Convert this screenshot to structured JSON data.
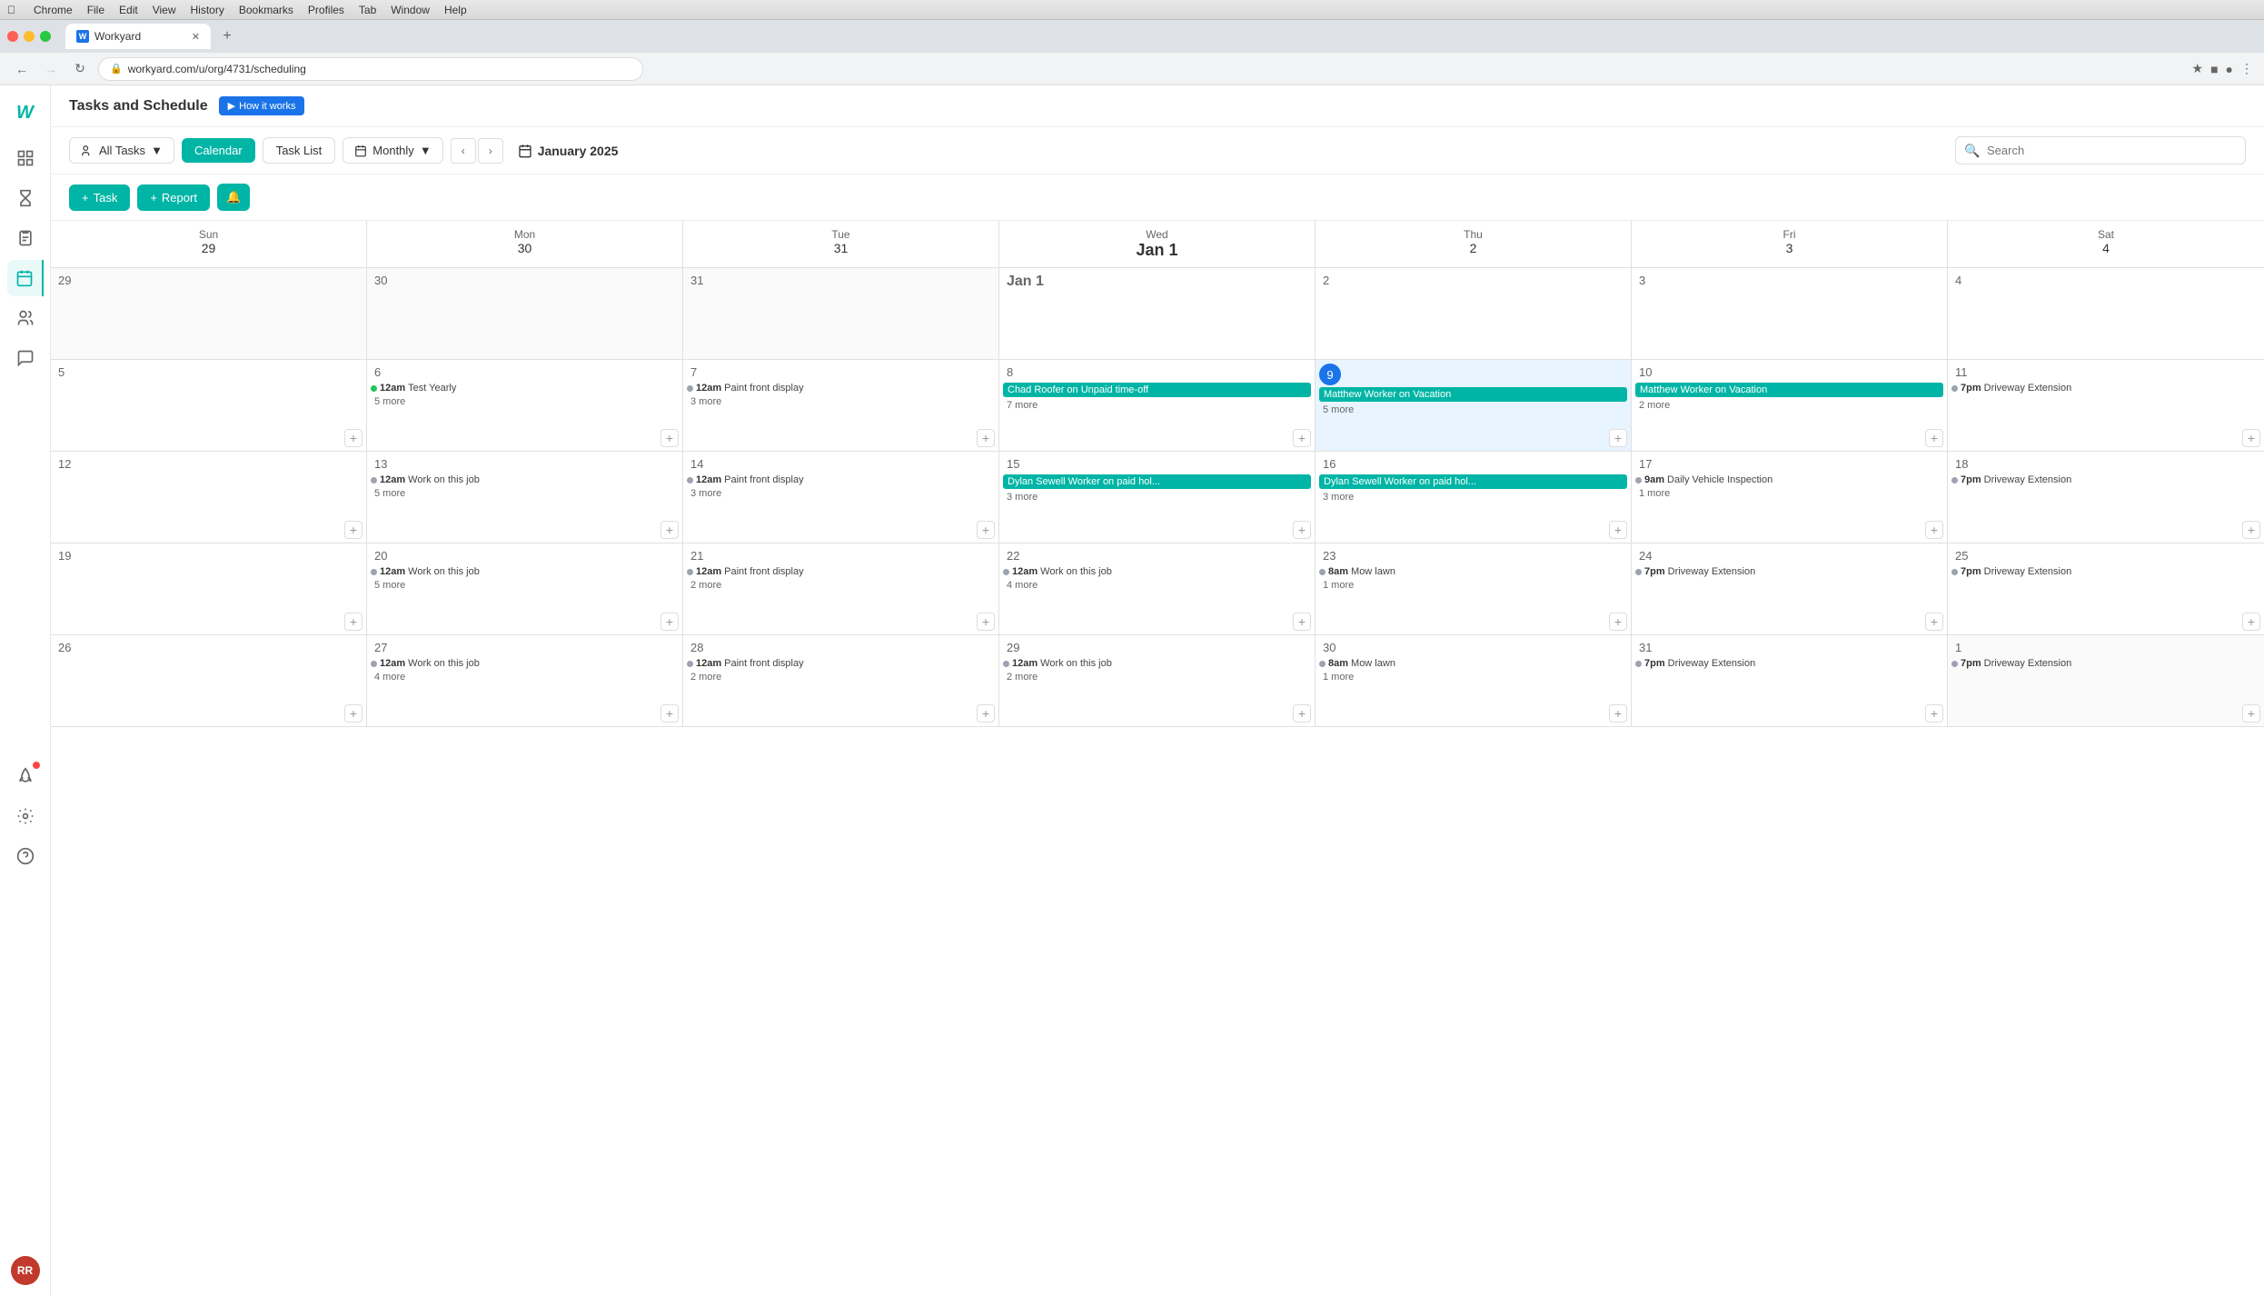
{
  "macos": {
    "menu_items": [
      "Apple",
      "Chrome",
      "File",
      "Edit",
      "View",
      "History",
      "Bookmarks",
      "Profiles",
      "Tab",
      "Window",
      "Help"
    ]
  },
  "tab": {
    "title": "Workyard",
    "favicon": "W"
  },
  "address": {
    "url": "workyard.com/u/org/4731/scheduling"
  },
  "header": {
    "title": "Tasks and Schedule",
    "how_it_works": "How it works"
  },
  "toolbar": {
    "all_tasks_label": "All Tasks",
    "calendar_label": "Calendar",
    "task_list_label": "Task List",
    "monthly_label": "Monthly",
    "month_display": "January 2025",
    "task_btn": "+ Task",
    "report_btn": "+ Report",
    "search_placeholder": "Search"
  },
  "calendar": {
    "day_headers": [
      {
        "day": "Sun",
        "num": "29",
        "today": false
      },
      {
        "day": "Mon",
        "num": "30",
        "today": false
      },
      {
        "day": "Tue",
        "num": "31",
        "today": false
      },
      {
        "day": "Wed",
        "num": "Jan 1",
        "today": false
      },
      {
        "day": "Thu",
        "num": "2",
        "today": false
      },
      {
        "day": "Fri",
        "num": "3",
        "today": false
      },
      {
        "day": "Sat",
        "num": "4",
        "today": false
      }
    ],
    "weeks": [
      {
        "days": [
          {
            "date": "29",
            "other": true,
            "events": [],
            "more": null
          },
          {
            "date": "30",
            "other": true,
            "events": [],
            "more": null
          },
          {
            "date": "31",
            "other": true,
            "events": [],
            "more": null
          },
          {
            "date": "Jan 1",
            "other": false,
            "big": true,
            "events": [],
            "more": null
          },
          {
            "date": "2",
            "other": false,
            "events": [],
            "more": null
          },
          {
            "date": "3",
            "other": false,
            "events": [],
            "more": null
          },
          {
            "date": "4",
            "other": false,
            "events": [],
            "more": null
          }
        ]
      },
      {
        "days": [
          {
            "date": "5",
            "other": false,
            "events": [],
            "more": null
          },
          {
            "date": "6",
            "other": false,
            "events": [
              {
                "type": "green-dot",
                "time": "12am",
                "text": "Test Yearly"
              }
            ],
            "more": "5 more"
          },
          {
            "date": "7",
            "other": false,
            "events": [
              {
                "type": "gray-dot",
                "time": "12am",
                "text": "Paint front display"
              }
            ],
            "more": "3 more"
          },
          {
            "date": "8",
            "other": false,
            "events": [
              {
                "type": "teal",
                "text": "Chad Roofer on Unpaid time-off"
              }
            ],
            "more": "7 more"
          },
          {
            "date": "9",
            "other": false,
            "today": true,
            "events": [
              {
                "type": "teal",
                "text": "Matthew Worker on Vacation"
              }
            ],
            "more": "5 more"
          },
          {
            "date": "10",
            "other": false,
            "events": [
              {
                "type": "teal",
                "text": "Matthew Worker on Vacation"
              }
            ],
            "more": "2 more"
          },
          {
            "date": "11",
            "other": false,
            "events": [
              {
                "type": "gray-dot",
                "time": "7pm",
                "text": "Driveway Extension"
              }
            ],
            "more": null
          }
        ]
      },
      {
        "days": [
          {
            "date": "12",
            "other": false,
            "events": [],
            "more": null
          },
          {
            "date": "13",
            "other": false,
            "events": [
              {
                "type": "gray-dot",
                "time": "12am",
                "text": "Work on this job"
              }
            ],
            "more": "5 more"
          },
          {
            "date": "14",
            "other": false,
            "events": [
              {
                "type": "gray-dot",
                "time": "12am",
                "text": "Paint front display"
              }
            ],
            "more": "3 more"
          },
          {
            "date": "15",
            "other": false,
            "events": [
              {
                "type": "teal",
                "text": "Dylan Sewell Worker on paid hol..."
              }
            ],
            "more": "3 more"
          },
          {
            "date": "16",
            "other": false,
            "events": [
              {
                "type": "teal",
                "text": "Dylan Sewell Worker on paid hol..."
              }
            ],
            "more": "3 more"
          },
          {
            "date": "17",
            "other": false,
            "events": [
              {
                "type": "gray-dot",
                "time": "9am",
                "text": "Daily Vehicle Inspection"
              }
            ],
            "more": "1 more"
          },
          {
            "date": "18",
            "other": false,
            "events": [
              {
                "type": "gray-dot",
                "time": "7pm",
                "text": "Driveway Extension"
              }
            ],
            "more": null
          }
        ]
      },
      {
        "days": [
          {
            "date": "19",
            "other": false,
            "events": [],
            "more": null
          },
          {
            "date": "20",
            "other": false,
            "events": [
              {
                "type": "gray-dot",
                "time": "12am",
                "text": "Work on this job"
              }
            ],
            "more": "5 more"
          },
          {
            "date": "21",
            "other": false,
            "events": [
              {
                "type": "gray-dot",
                "time": "12am",
                "text": "Paint front display"
              }
            ],
            "more": "2 more"
          },
          {
            "date": "22",
            "other": false,
            "events": [
              {
                "type": "gray-dot",
                "time": "12am",
                "text": "Work on this job"
              }
            ],
            "more": "4 more"
          },
          {
            "date": "23",
            "other": false,
            "events": [
              {
                "type": "gray-dot",
                "time": "8am",
                "text": "Mow lawn"
              }
            ],
            "more": "1 more"
          },
          {
            "date": "24",
            "other": false,
            "events": [
              {
                "type": "gray-dot",
                "time": "7pm",
                "text": "Driveway Extension"
              }
            ],
            "more": null
          },
          {
            "date": "25",
            "other": false,
            "events": [
              {
                "type": "gray-dot",
                "time": "7pm",
                "text": "Driveway Extension"
              }
            ],
            "more": null
          }
        ]
      },
      {
        "days": [
          {
            "date": "26",
            "other": false,
            "events": [],
            "more": null
          },
          {
            "date": "27",
            "other": false,
            "events": [
              {
                "type": "gray-dot",
                "time": "12am",
                "text": "Work on this job"
              }
            ],
            "more": "4 more"
          },
          {
            "date": "28",
            "other": false,
            "events": [
              {
                "type": "gray-dot",
                "time": "12am",
                "text": "Paint front display"
              }
            ],
            "more": "2 more"
          },
          {
            "date": "29",
            "other": false,
            "events": [
              {
                "type": "gray-dot",
                "time": "12am",
                "text": "Work on this job"
              }
            ],
            "more": "2 more"
          },
          {
            "date": "30",
            "other": false,
            "events": [
              {
                "type": "gray-dot",
                "time": "8am",
                "text": "Mow lawn"
              }
            ],
            "more": "1 more"
          },
          {
            "date": "31",
            "other": false,
            "events": [
              {
                "type": "gray-dot",
                "time": "7pm",
                "text": "Driveway Extension"
              }
            ],
            "more": null
          },
          {
            "date": "1",
            "other": true,
            "events": [
              {
                "type": "gray-dot",
                "time": "7pm",
                "text": "Driveway Extension"
              }
            ],
            "more": null
          }
        ]
      }
    ]
  },
  "sidebar": {
    "logo": "W",
    "avatar_initials": "RR",
    "items": [
      {
        "name": "dashboard",
        "icon": "grid"
      },
      {
        "name": "tasks",
        "icon": "hourglass"
      },
      {
        "name": "reports",
        "icon": "clipboard"
      },
      {
        "name": "calendar",
        "icon": "calendar",
        "active": true
      },
      {
        "name": "people",
        "icon": "person"
      },
      {
        "name": "messages",
        "icon": "chat"
      },
      {
        "name": "rocket",
        "icon": "rocket",
        "badge": true
      },
      {
        "name": "settings",
        "icon": "gear"
      },
      {
        "name": "help",
        "icon": "question"
      }
    ]
  }
}
